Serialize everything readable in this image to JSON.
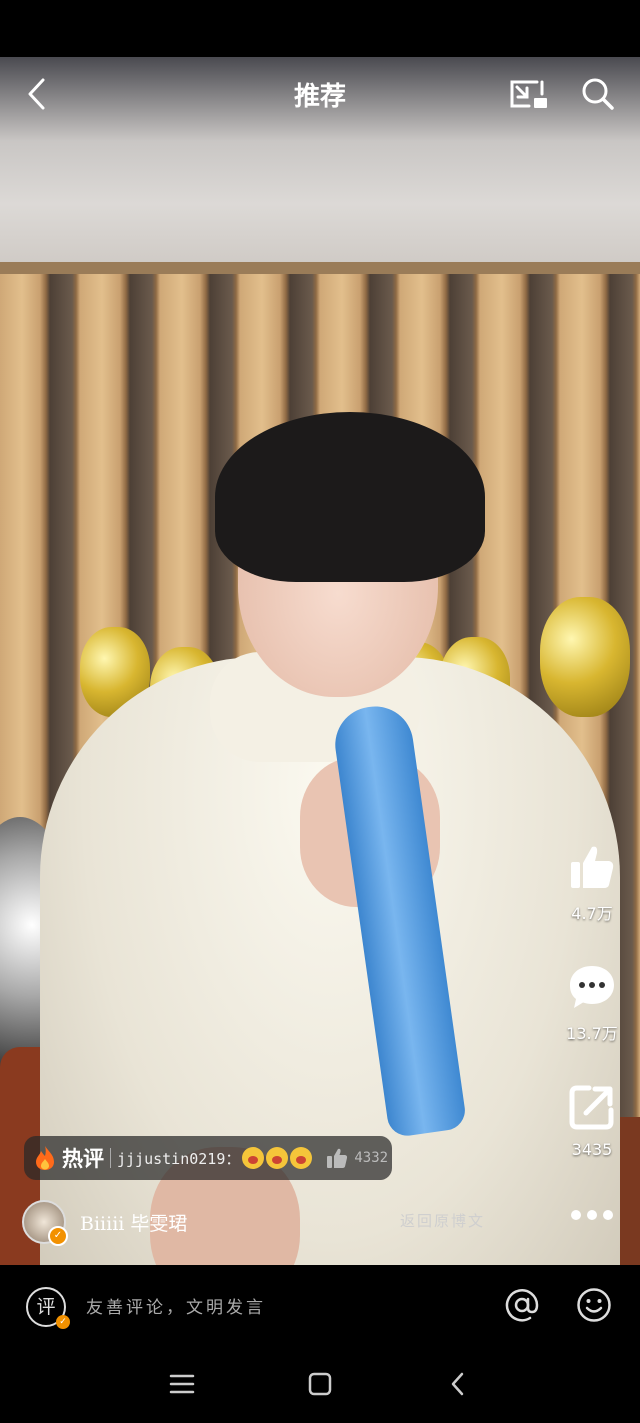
{
  "header": {
    "title": "推荐"
  },
  "actions": {
    "like_count": "4.7万",
    "comment_count": "13.7万",
    "share_count": "3435"
  },
  "hot_comment": {
    "tag": "热评",
    "user": "jjjustin0219：",
    "like_count": "4332"
  },
  "author": {
    "name": "Biiiii 毕雯珺",
    "back_link": "返回原博文"
  },
  "comment_bar": {
    "placeholder": "友善评论，文明发言"
  },
  "colors": {
    "accent_orange": "#f29100",
    "mic_blue": "#4a90d9"
  }
}
